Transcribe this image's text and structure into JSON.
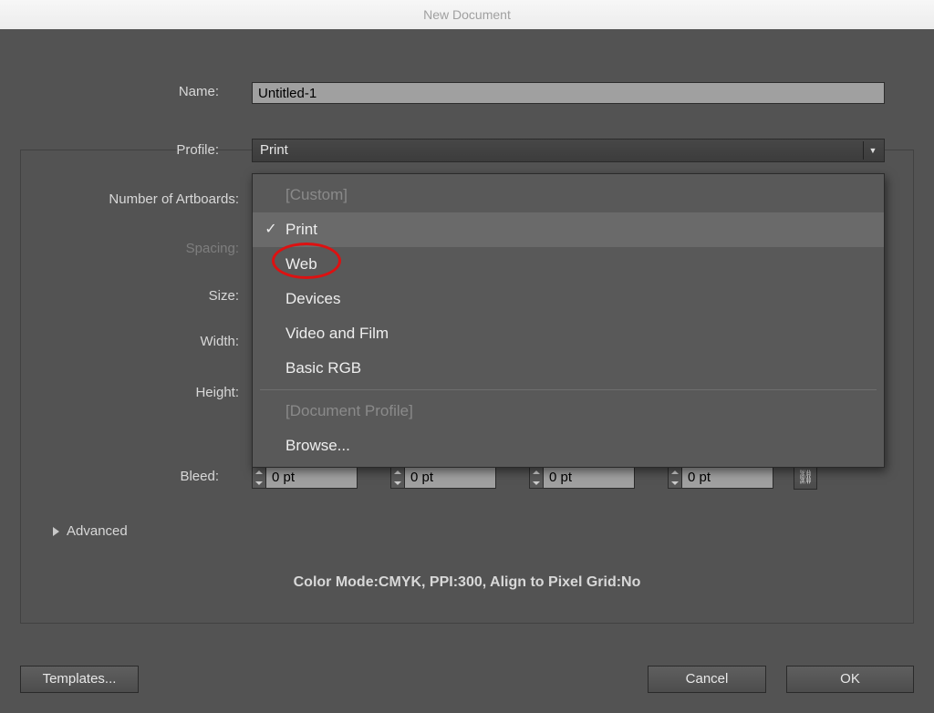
{
  "window": {
    "title": "New Document"
  },
  "name": {
    "label": "Name:",
    "value": "Untitled-1"
  },
  "profile": {
    "label": "Profile:",
    "value": "Print",
    "options": {
      "custom": "[Custom]",
      "print": "Print",
      "web": "Web",
      "devices": "Devices",
      "video": "Video and Film",
      "basic_rgb": "Basic RGB",
      "doc_profile": "[Document Profile]",
      "browse": "Browse..."
    }
  },
  "labels": {
    "artboards": "Number of Artboards:",
    "spacing": "Spacing:",
    "size": "Size:",
    "width": "Width:",
    "height": "Height:",
    "bleed": "Bleed:"
  },
  "bleed": {
    "top": "0 pt",
    "bottom": "0 pt",
    "left": "0 pt",
    "right": "0 pt"
  },
  "advanced": {
    "label": "Advanced"
  },
  "summary": "Color Mode:CMYK, PPI:300, Align to Pixel Grid:No",
  "buttons": {
    "templates": "Templates...",
    "cancel": "Cancel",
    "ok": "OK"
  },
  "icons": {
    "dropdown_caret": "▼",
    "checkmark": "✓",
    "link": "⛓"
  }
}
